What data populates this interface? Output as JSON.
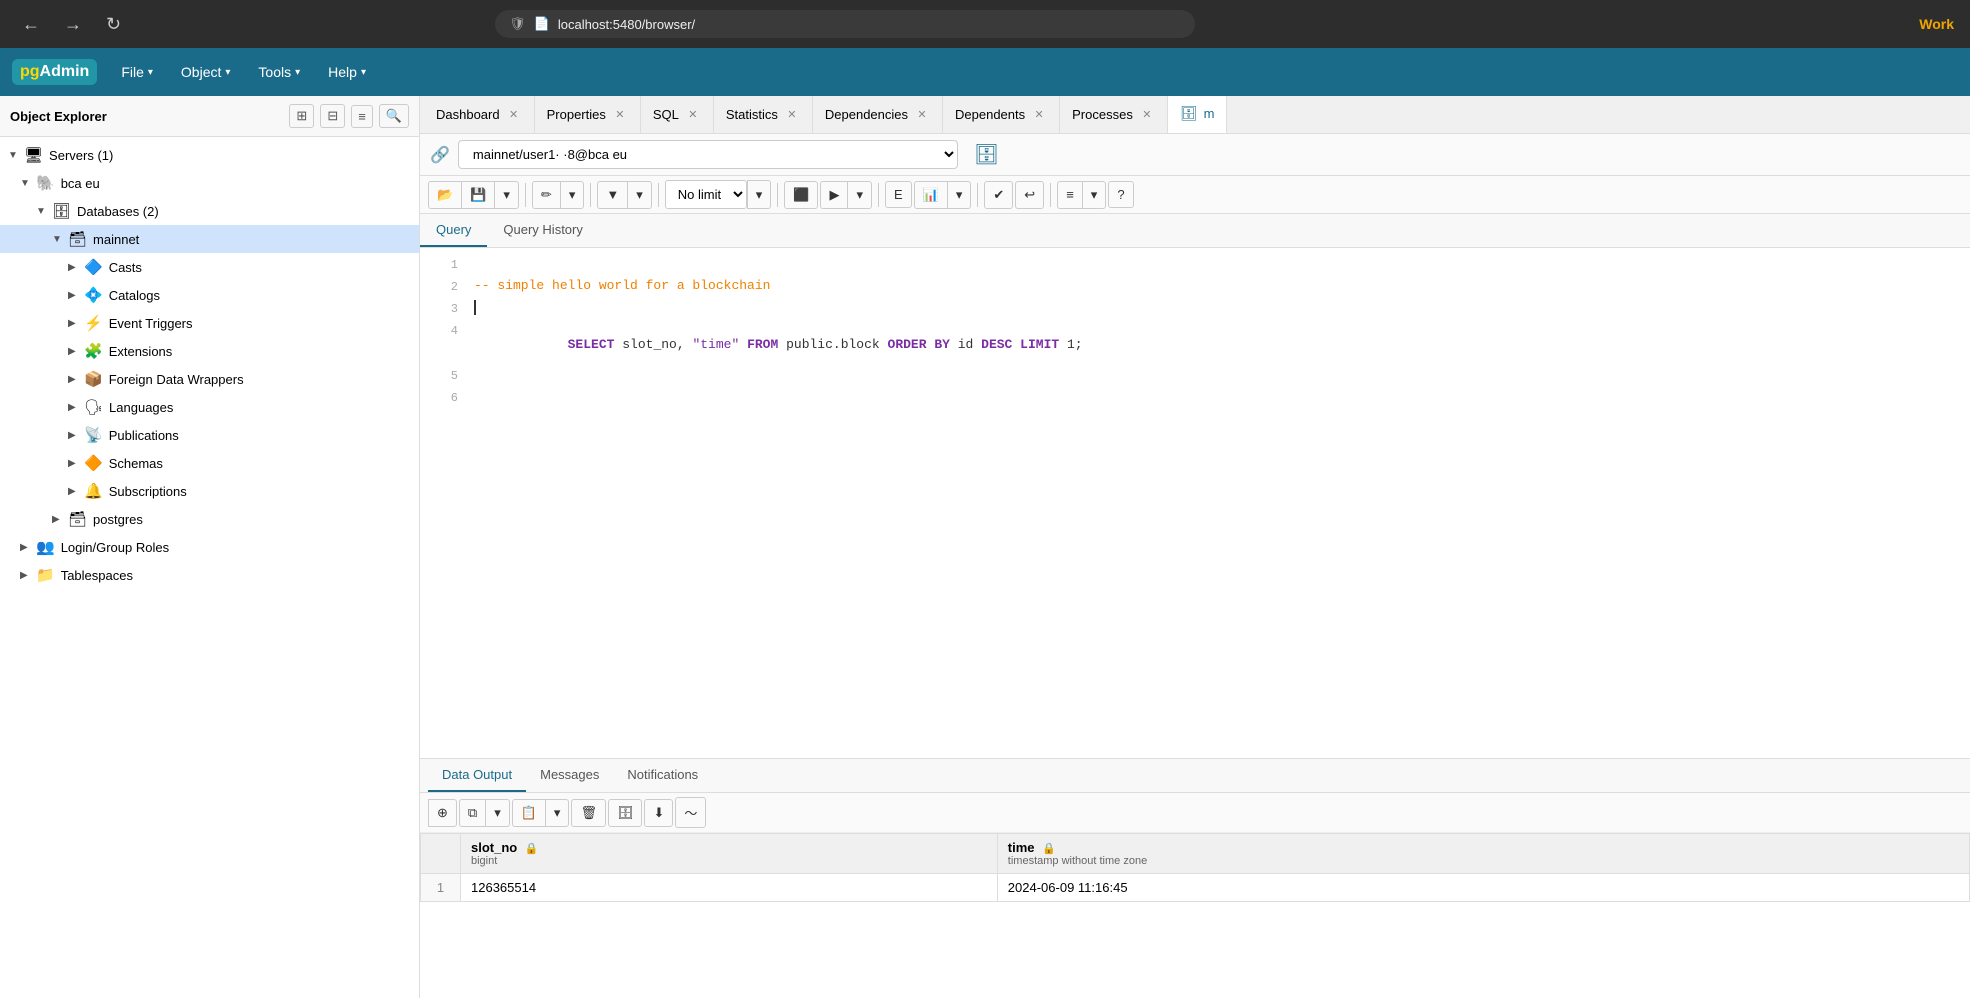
{
  "browser": {
    "address": "localhost:5480/browser/",
    "nav_back": "←",
    "nav_forward": "→",
    "nav_refresh": "↻",
    "work_label": "Work"
  },
  "header": {
    "logo_pg": "pg",
    "logo_admin": "Admin",
    "menu_items": [
      {
        "label": "File",
        "id": "file"
      },
      {
        "label": "Object",
        "id": "object"
      },
      {
        "label": "Tools",
        "id": "tools"
      },
      {
        "label": "Help",
        "id": "help"
      }
    ]
  },
  "sidebar": {
    "title": "Object Explorer",
    "tree": [
      {
        "level": 0,
        "expanded": true,
        "icon": "🖥",
        "label": "Servers (1)",
        "id": "servers"
      },
      {
        "level": 1,
        "expanded": true,
        "icon": "🐘",
        "label": "bca eu",
        "id": "bca-eu"
      },
      {
        "level": 2,
        "expanded": true,
        "icon": "🗄",
        "label": "Databases (2)",
        "id": "databases"
      },
      {
        "level": 3,
        "expanded": true,
        "icon": "🗃",
        "label": "mainnet",
        "id": "mainnet",
        "selected": true
      },
      {
        "level": 4,
        "expanded": false,
        "icon": "🔷",
        "label": "Casts",
        "id": "casts"
      },
      {
        "level": 4,
        "expanded": false,
        "icon": "💠",
        "label": "Catalogs",
        "id": "catalogs"
      },
      {
        "level": 4,
        "expanded": false,
        "icon": "⚡",
        "label": "Event Triggers",
        "id": "event-triggers"
      },
      {
        "level": 4,
        "expanded": false,
        "icon": "🧩",
        "label": "Extensions",
        "id": "extensions"
      },
      {
        "level": 4,
        "expanded": false,
        "icon": "📦",
        "label": "Foreign Data Wrappers",
        "id": "foreign-data"
      },
      {
        "level": 4,
        "expanded": false,
        "icon": "🗣",
        "label": "Languages",
        "id": "languages"
      },
      {
        "level": 4,
        "expanded": false,
        "icon": "📡",
        "label": "Publications",
        "id": "publications"
      },
      {
        "level": 4,
        "expanded": false,
        "icon": "🔶",
        "label": "Schemas",
        "id": "schemas"
      },
      {
        "level": 4,
        "expanded": false,
        "icon": "🔔",
        "label": "Subscriptions",
        "id": "subscriptions"
      },
      {
        "level": 3,
        "expanded": false,
        "icon": "🗃",
        "label": "postgres",
        "id": "postgres"
      },
      {
        "level": 1,
        "expanded": false,
        "icon": "👥",
        "label": "Login/Group Roles",
        "id": "login-roles"
      },
      {
        "level": 1,
        "expanded": false,
        "icon": "📁",
        "label": "Tablespaces",
        "id": "tablespaces"
      }
    ]
  },
  "tabs": [
    {
      "label": "Dashboard",
      "id": "dashboard",
      "active": false
    },
    {
      "label": "Properties",
      "id": "properties",
      "active": false
    },
    {
      "label": "SQL",
      "id": "sql",
      "active": false
    },
    {
      "label": "Statistics",
      "id": "statistics",
      "active": false
    },
    {
      "label": "Dependencies",
      "id": "dependencies",
      "active": false
    },
    {
      "label": "Dependents",
      "id": "dependents",
      "active": false
    },
    {
      "label": "Processes",
      "id": "processes",
      "active": false
    },
    {
      "label": "m",
      "id": "more",
      "active": true
    }
  ],
  "query_editor": {
    "connection": "mainnet/user1·  ·8@bca eu",
    "query_tab_label": "Query",
    "history_tab_label": "Query History",
    "lines": [
      {
        "num": 1,
        "content": ""
      },
      {
        "num": 2,
        "content": "-- simple hello world for a blockchain",
        "type": "comment"
      },
      {
        "num": 3,
        "content": "|",
        "type": "cursor"
      },
      {
        "num": 4,
        "content": "SELECT slot_no, \"time\" FROM public.block ORDER BY id DESC LIMIT 1;",
        "type": "code"
      },
      {
        "num": 5,
        "content": ""
      },
      {
        "num": 6,
        "content": ""
      }
    ],
    "no_limit_label": "No limit"
  },
  "results": {
    "tabs": [
      {
        "label": "Data Output",
        "id": "data-output",
        "active": true
      },
      {
        "label": "Messages",
        "id": "messages",
        "active": false
      },
      {
        "label": "Notifications",
        "id": "notifications",
        "active": false
      }
    ],
    "columns": [
      {
        "name": "slot_no",
        "type": "bigint",
        "locked": true
      },
      {
        "name": "time",
        "type": "timestamp without time zone",
        "locked": true
      }
    ],
    "rows": [
      {
        "rownum": 1,
        "slot_no": "126365514",
        "time": "2024-06-09 11:16:45"
      }
    ]
  }
}
